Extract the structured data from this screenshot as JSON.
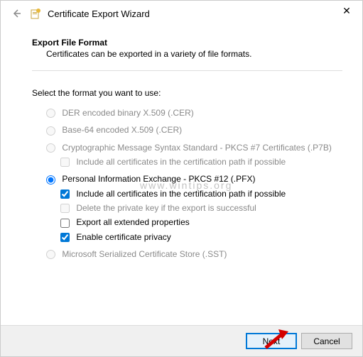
{
  "window": {
    "title": "Certificate Export Wizard"
  },
  "header": {
    "section_title": "Export File Format",
    "section_desc": "Certificates can be exported in a variety of file formats."
  },
  "prompt": "Select the format you want to use:",
  "formats": {
    "der": "DER encoded binary X.509 (.CER)",
    "base64": "Base-64 encoded X.509 (.CER)",
    "pkcs7": "Cryptographic Message Syntax Standard - PKCS #7 Certificates (.P7B)",
    "pkcs7_include": "Include all certificates in the certification path if possible",
    "pfx": "Personal Information Exchange - PKCS #12 (.PFX)",
    "pfx_include": "Include all certificates in the certification path if possible",
    "pfx_delete": "Delete the private key if the export is successful",
    "pfx_ext": "Export all extended properties",
    "pfx_privacy": "Enable certificate privacy",
    "sst": "Microsoft Serialized Certificate Store (.SST)"
  },
  "buttons": {
    "next": "Next",
    "cancel": "Cancel"
  },
  "watermark": "www.wintips.org"
}
